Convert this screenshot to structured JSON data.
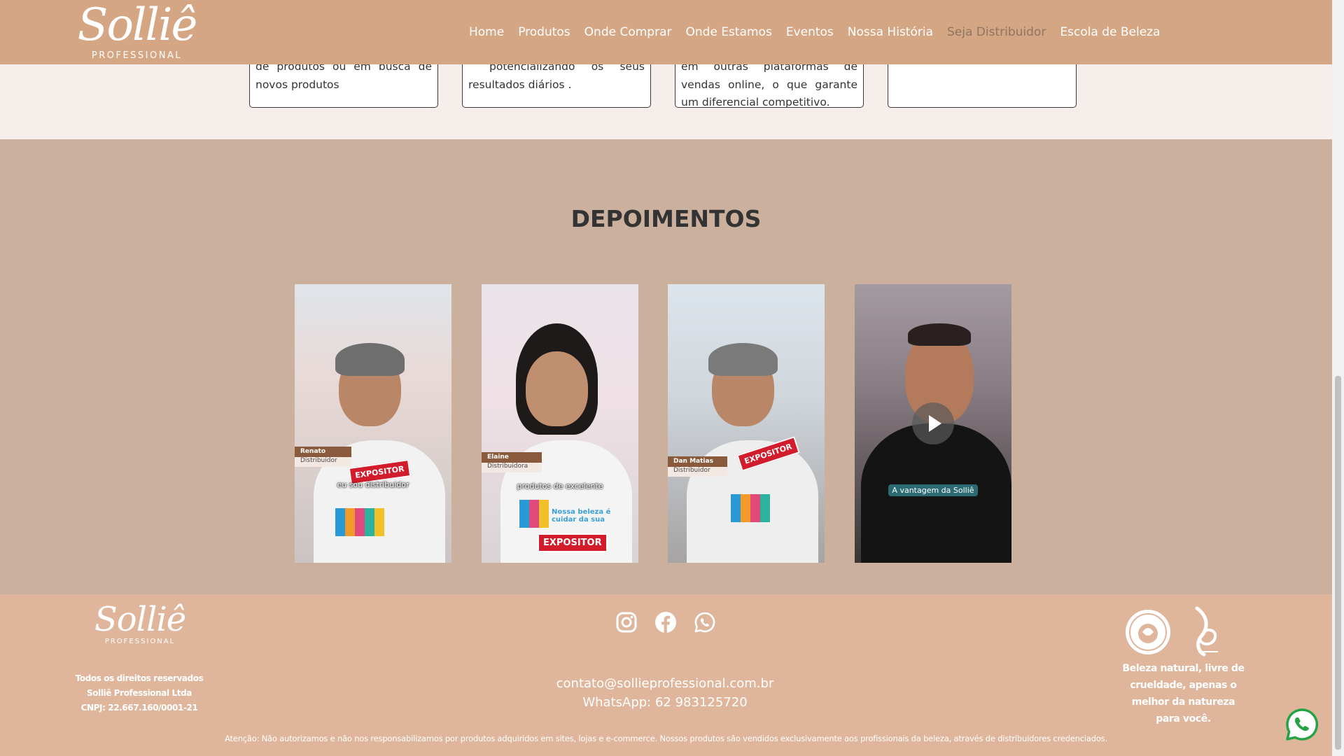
{
  "header": {
    "logo_word": "Solliê",
    "logo_sub": "PROFESSIONAL",
    "nav": [
      {
        "label": "Home"
      },
      {
        "label": "Produtos"
      },
      {
        "label": "Onde Comprar"
      },
      {
        "label": "Onde Estamos"
      },
      {
        "label": "Eventos"
      },
      {
        "label": "Nossa História"
      },
      {
        "label": "Seja Distribuidor",
        "active": true
      },
      {
        "label": "Escola de Beleza"
      }
    ]
  },
  "cards": [
    {
      "text": "de produtos ou em busca de novos produtos"
    },
    {
      "text": "potencializando os seus resultados diários ."
    },
    {
      "text": "em outras plataformas de vendas online, o que garante um diferencial competitivo."
    },
    {
      "text": ""
    }
  ],
  "testimonials": {
    "title": "DEPOIMENTOS",
    "videos": [
      {
        "name_line1": "Renato",
        "name_line2": "Distribuidor",
        "caption": "eu sou distribuidor",
        "badge": "EXPOSITOR"
      },
      {
        "name_line1": "Elaine",
        "name_line2": "Distribuidora",
        "caption": "produtos de excelente",
        "badge": "EXPOSITOR",
        "shirt_text": "Nossa beleza é cuidar da sua"
      },
      {
        "name_line1": "Dan Matias",
        "name_line2": "Distribuidor",
        "caption": "",
        "badge": "EXPOSITOR"
      },
      {
        "name_line1": "",
        "name_line2": "",
        "caption": "A vantagem da Solliê",
        "badge": "",
        "has_play": true
      }
    ]
  },
  "footer": {
    "logo_word": "Solliê",
    "logo_sub": "PROFESSIONAL",
    "rights": [
      "Todos os direitos reservados",
      "Solliê Professional Ltda",
      "CNPJ: 22.667.160/0001-21"
    ],
    "social": [
      {
        "icon": "instagram-icon"
      },
      {
        "icon": "facebook-icon"
      },
      {
        "icon": "whatsapp-icon"
      }
    ],
    "email": "contato@sollieprofessional.com.br",
    "whatsapp": "WhatsApp: 62 983125720",
    "slogan": "Beleza natural, livre de crueldade, apenas o melhor da natureza para você.",
    "notice": "Atenção: Não autorizamos e não nos responsabilizamos por produtos adquiridos em sites, lojas e e-commerce. Nossos produtos são vendidos exclusivamente aos profissionais da beleza, através de distribuidores credenciados."
  },
  "colors": {
    "header_bg": "#d4a684",
    "testimonials_bg": "#cbb09d",
    "footer_bg": "#dfb69c",
    "nav_active": "#8d7562"
  }
}
